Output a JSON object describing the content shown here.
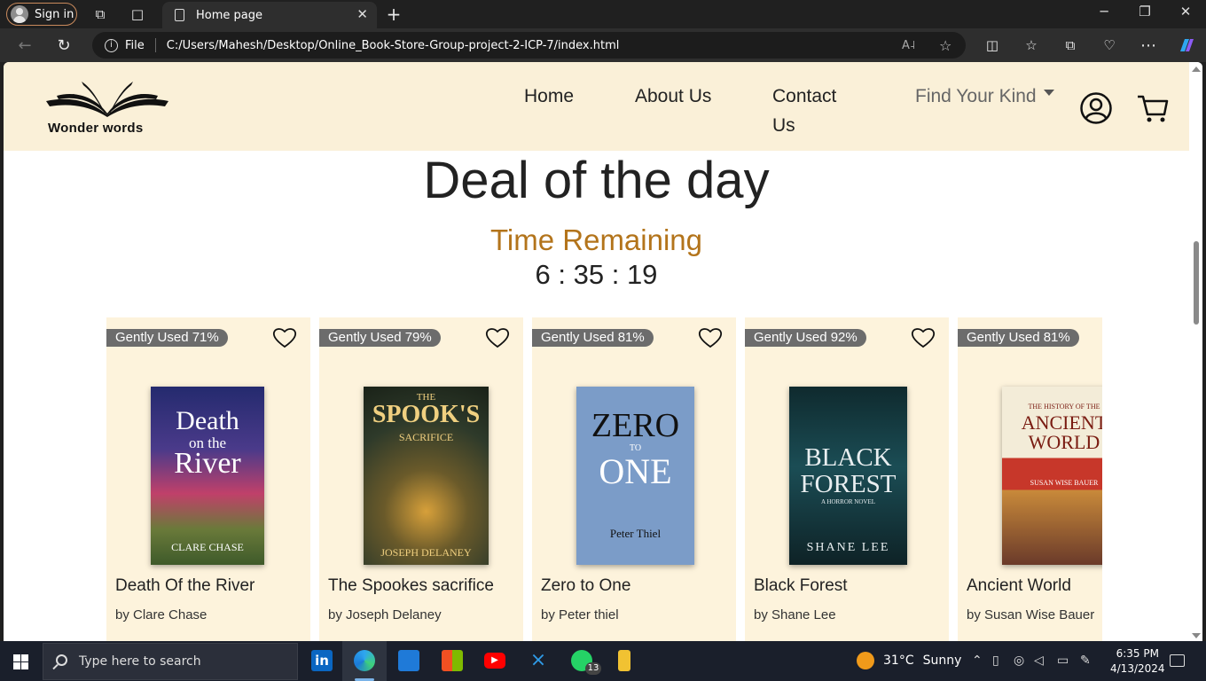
{
  "browser": {
    "signin_label": "Sign in",
    "tab_title": "Home page",
    "url_scheme_label": "File",
    "url": "C:/Users/Mahesh/Desktop/Online_Book-Store-Group-project-2-ICP-7/index.html"
  },
  "site": {
    "logo_text": "Wonder words",
    "nav": {
      "home": "Home",
      "about": "About Us",
      "contact": "Contact Us",
      "find_kind": "Find Your Kind"
    }
  },
  "deal": {
    "title": "Deal of the day",
    "time_label": "Time Remaining",
    "time_value": "6 : 35 : 19"
  },
  "books": [
    {
      "badge": "Gently Used 71%",
      "title": "Death Of the River",
      "author": "by Clare Chase"
    },
    {
      "badge": "Gently Used 79%",
      "title": "The Spookes sacrifice",
      "author": "by Joseph Delaney"
    },
    {
      "badge": "Gently Used 81%",
      "title": "Zero to One",
      "author": "by Peter thiel"
    },
    {
      "badge": "Gently Used 92%",
      "title": "Black Forest",
      "author": "by Shane Lee"
    },
    {
      "badge": "Gently Used 81%",
      "title": "Ancient World",
      "author": "by Susan Wise Bauer"
    }
  ],
  "covers": [
    {
      "line1": "Death",
      "line2": "on the",
      "line3": "River",
      "author": "CLARE CHASE"
    },
    {
      "line1": "THE",
      "line2": "SPOOK'S",
      "line3": "SACRIFICE",
      "author": "JOSEPH DELANEY"
    },
    {
      "line1": "ZERO",
      "line2": "TO",
      "line3": "ONE",
      "author": "Peter Thiel"
    },
    {
      "line1": "BLACK",
      "line2": "FOREST",
      "line3": "A HORROR NOVEL",
      "author": "SHANE LEE"
    },
    {
      "line1": "THE HISTORY OF THE",
      "line2": "ANCIENT",
      "line3": "WORLD",
      "author": "SUSAN WISE BAUER"
    }
  ],
  "taskbar": {
    "search_placeholder": "Type here to search",
    "whatsapp_badge": "13",
    "weather_temp": "31°C",
    "weather_cond": "Sunny",
    "time": "6:35 PM",
    "date": "4/13/2024"
  }
}
